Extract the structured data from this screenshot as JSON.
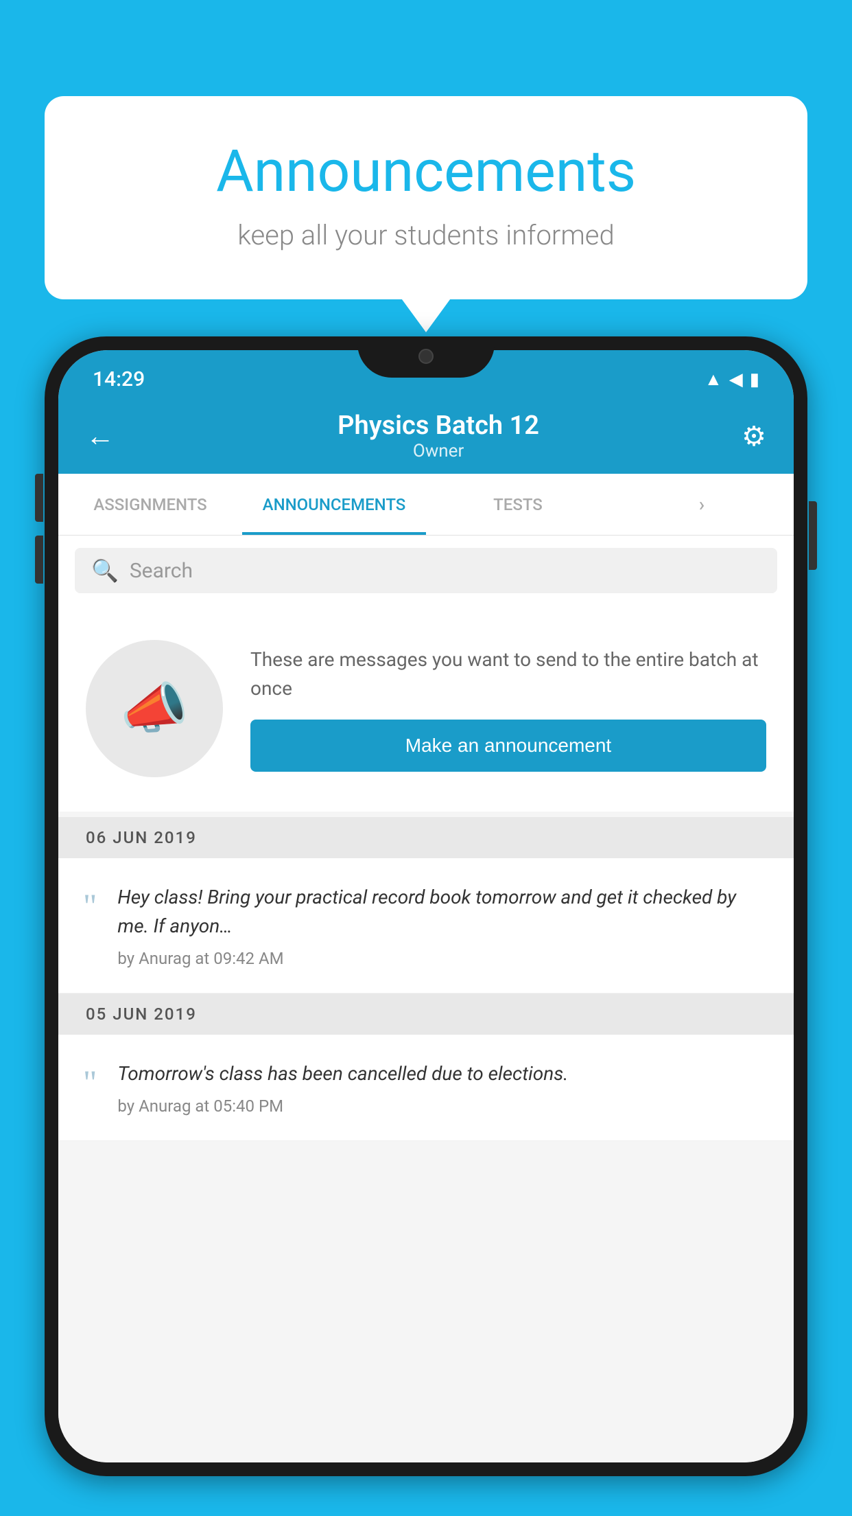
{
  "background_color": "#1ab7ea",
  "speech_bubble": {
    "title": "Announcements",
    "subtitle": "keep all your students informed"
  },
  "status_bar": {
    "time": "14:29",
    "icons": [
      "wifi",
      "signal",
      "battery"
    ]
  },
  "app_bar": {
    "back_label": "←",
    "title": "Physics Batch 12",
    "subtitle": "Owner",
    "settings_label": "⚙"
  },
  "tabs": [
    {
      "label": "ASSIGNMENTS",
      "active": false
    },
    {
      "label": "ANNOUNCEMENTS",
      "active": true
    },
    {
      "label": "TESTS",
      "active": false
    },
    {
      "label": "›",
      "active": false
    }
  ],
  "search": {
    "placeholder": "Search"
  },
  "empty_state": {
    "description_text": "These are messages you want to send to the entire batch at once",
    "button_label": "Make an announcement"
  },
  "announcements": [
    {
      "date": "06  JUN  2019",
      "items": [
        {
          "text": "Hey class! Bring your practical record book tomorrow and get it checked by me. If anyon…",
          "meta": "by Anurag at 09:42 AM"
        }
      ]
    },
    {
      "date": "05  JUN  2019",
      "items": [
        {
          "text": "Tomorrow's class has been cancelled due to elections.",
          "meta": "by Anurag at 05:40 PM"
        }
      ]
    }
  ]
}
